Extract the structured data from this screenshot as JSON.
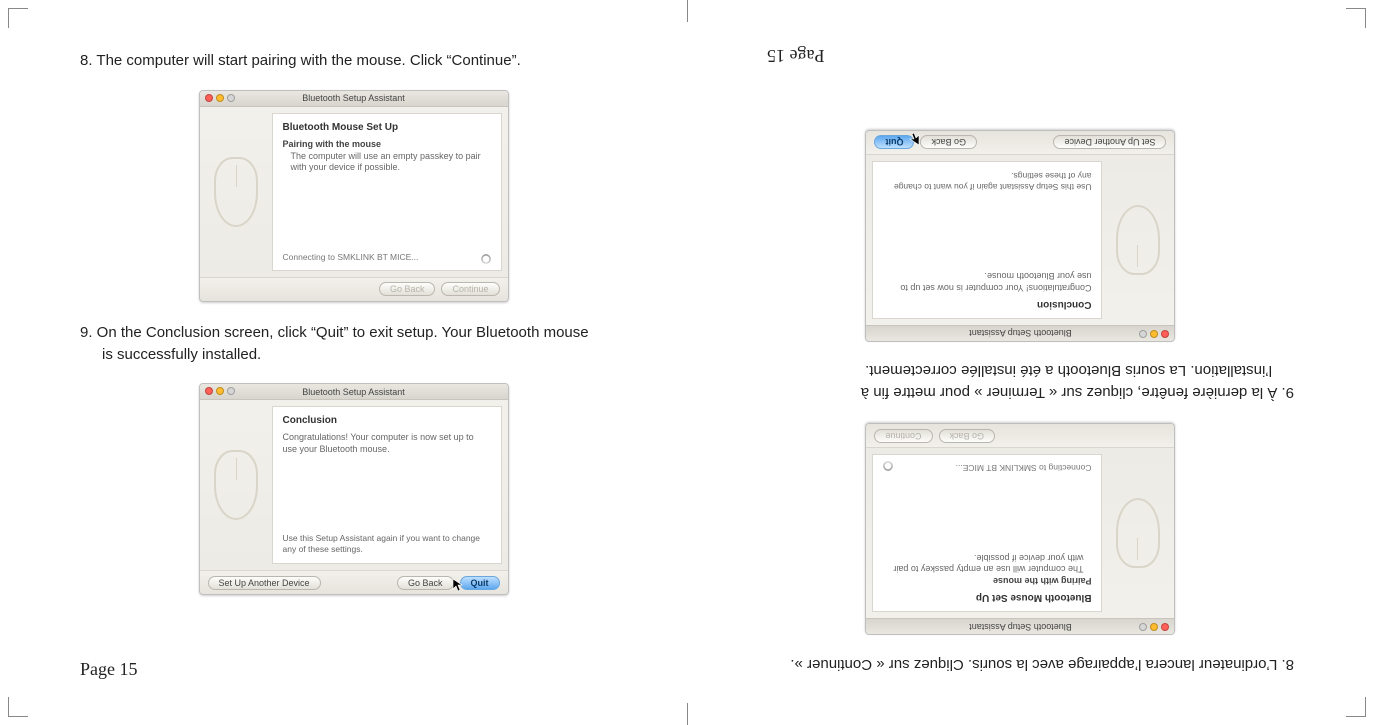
{
  "left": {
    "step8": "8. The computer will start pairing with the mouse. Click “Continue”.",
    "step9_line1": "9. On the Conclusion screen, click “Quit” to exit setup. Your Bluetooth mouse",
    "step9_line2": "is successfully installed.",
    "page_label": "Page 15"
  },
  "right": {
    "step8": "8. L’ordinateur lancera l’appairage avec la souris. Cliquez sur « Continuer ».",
    "step9_line1": "9. À la dernière fenêtre, cliquez sur « Terminer » pour mettre fin à",
    "step9_line2": "l’installation. La souris Bluetooth a été installée correctement.",
    "page_label": "Page 15"
  },
  "window_pairing": {
    "title": "Bluetooth Setup Assistant",
    "heading": "Bluetooth Mouse Set Up",
    "subheading": "Pairing with the mouse",
    "body": "The computer will use an empty passkey to pair with your device if possible.",
    "status": "Connecting to SMKLINK BT MICE...",
    "btn_back": "Go Back",
    "btn_continue": "Continue"
  },
  "window_conclusion": {
    "title": "Bluetooth Setup Assistant",
    "heading": "Conclusion",
    "body": "Congratulations! Your computer is now set up to use your Bluetooth mouse.",
    "footnote": "Use this Setup Assistant again if you want to change any of these settings.",
    "btn_setup_another": "Set Up Another Device",
    "btn_back": "Go Back",
    "btn_quit": "Quit"
  }
}
